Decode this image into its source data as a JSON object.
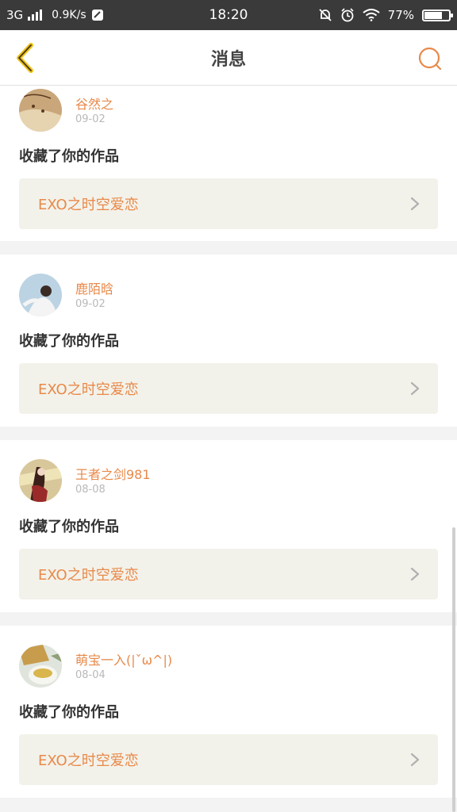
{
  "status_bar": {
    "network": "3G",
    "speed": "0.9K/s",
    "time": "18:20",
    "battery": "77%",
    "battery_level": 0.77
  },
  "nav": {
    "title": "消息",
    "accent_color": "#e8894a"
  },
  "messages": [
    {
      "user": "谷然之",
      "date": "09-02",
      "action": "收藏了你的作品",
      "work_title": "EXO之时空爱恋"
    },
    {
      "user": "鹿陌晗",
      "date": "09-02",
      "action": "收藏了你的作品",
      "work_title": "EXO之时空爱恋"
    },
    {
      "user": "王者之剑981",
      "date": "08-08",
      "action": "收藏了你的作品",
      "work_title": "EXO之时空爱恋"
    },
    {
      "user": "萌宝一入(|ˇω^|)",
      "date": "08-04",
      "action": "收藏了你的作品",
      "work_title": "EXO之时空爱恋"
    }
  ]
}
